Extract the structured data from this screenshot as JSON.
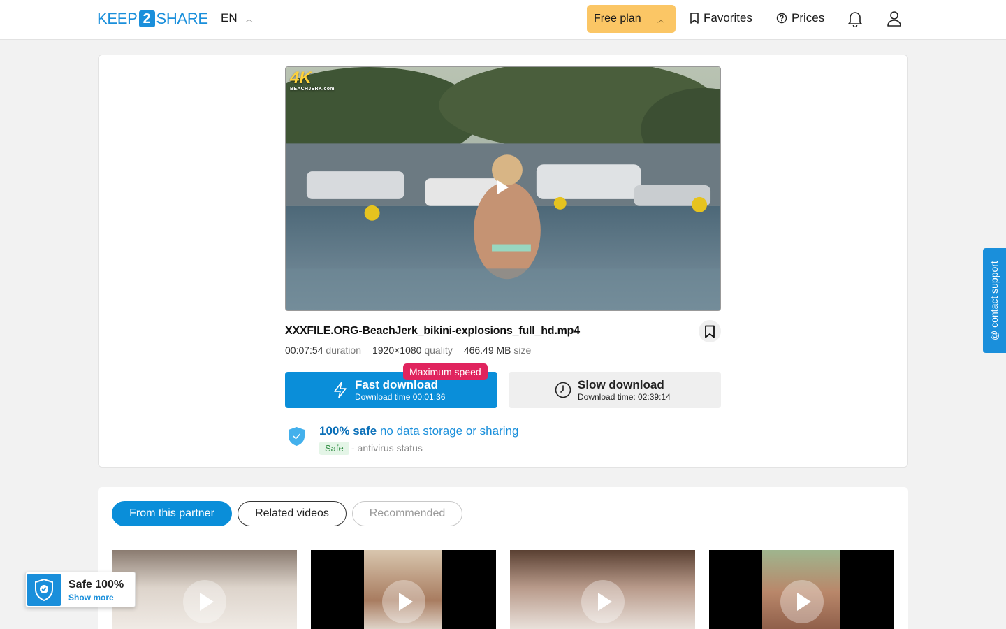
{
  "header": {
    "logo_left": "KEEP",
    "logo_mid": "2",
    "logo_right": "SHARE",
    "language": "EN",
    "plan_label": "Free plan",
    "favorites_label": "Favorites",
    "prices_label": "Prices"
  },
  "video": {
    "watermark": "4K",
    "watermark_sub": "BEACHJERK.com"
  },
  "file": {
    "name": "XXXFILE.ORG-BeachJerk_bikini-explosions_full_hd.mp4",
    "duration": "00:07:54",
    "duration_label": "duration",
    "quality": "1920×1080",
    "quality_label": "quality",
    "size": "466.49 MB",
    "size_label": "size"
  },
  "download": {
    "fast_label": "Fast download",
    "fast_time": "Download time 00:01:36",
    "max_speed_badge": "Maximum speed",
    "slow_label": "Slow download",
    "slow_time": "Download time: 02:39:14"
  },
  "safety": {
    "safe_bold": "100% safe",
    "safe_text": "no data storage or sharing",
    "tag": "Safe",
    "av_text": "- antivirus status"
  },
  "tabs": [
    {
      "label": "From this partner",
      "active": true
    },
    {
      "label": "Related videos",
      "active": false
    },
    {
      "label": "Recommended",
      "active": false
    }
  ],
  "contact_support": "@ contact support",
  "safe_widget": {
    "title": "Safe 100%",
    "link": "Show more"
  },
  "colors": {
    "accent": "#0a8ed9",
    "plan": "#fbc665",
    "badge": "#e0245e"
  }
}
